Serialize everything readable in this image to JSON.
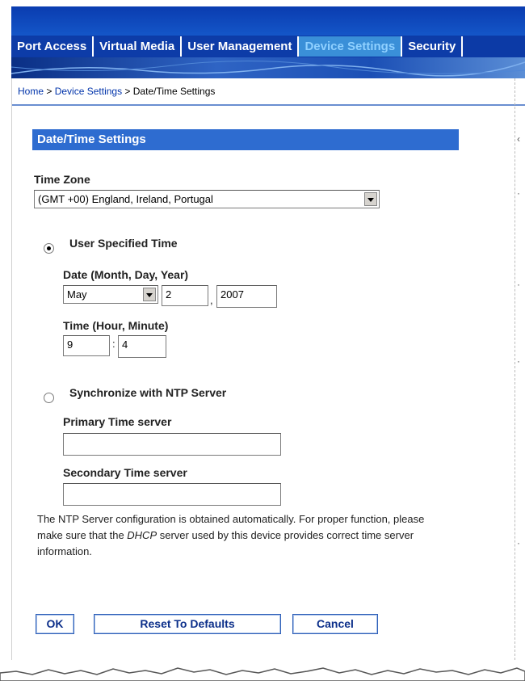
{
  "tabs": [
    {
      "label": "Port Access"
    },
    {
      "label": "Virtual Media"
    },
    {
      "label": "User Management"
    },
    {
      "label": "Device Settings"
    },
    {
      "label": "Security"
    }
  ],
  "breadcrumb": {
    "home": "Home",
    "sep1": " > ",
    "device": "Device Settings",
    "sep2": " > ",
    "current": "Date/Time Settings"
  },
  "panel": {
    "title": "Date/Time Settings"
  },
  "timezone": {
    "label": "Time Zone",
    "value": "(GMT +00) England, Ireland, Portugal"
  },
  "user_time": {
    "label": "User Specified Time",
    "date_label": "Date (Month, Day, Year)",
    "month": "May",
    "day": "2",
    "comma": ",",
    "year": "2007",
    "time_label": "Time (Hour, Minute)",
    "hour": "9",
    "colon": ":",
    "minute": "4"
  },
  "ntp": {
    "label": "Synchronize with NTP Server",
    "primary_label": "Primary Time server",
    "primary_value": "",
    "secondary_label": "Secondary Time server",
    "secondary_value": "",
    "note_part1": "The NTP Server configuration is obtained automatically. For proper function, please make sure that the ",
    "note_dhcp": "DHCP",
    "note_part2": " server used by this device provides correct time server information."
  },
  "buttons": {
    "ok": "OK",
    "reset": "Reset To Defaults",
    "cancel": "Cancel"
  },
  "colors": {
    "tab_bar": "#0c3aa6",
    "active_tab": "#3a8fd8",
    "panel_title": "#2e6cd0"
  }
}
